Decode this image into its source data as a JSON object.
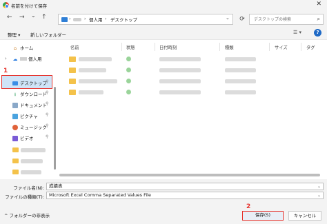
{
  "window": {
    "title": "名前を付けて保存",
    "close": "✕"
  },
  "nav": {
    "back": "←",
    "forward": "→",
    "down": "⌄",
    "up": "↑",
    "refresh": "⟳"
  },
  "address": {
    "sep1": "›",
    "path1": "個人用",
    "sep2": "›",
    "path2": "デスクトップ",
    "dropdown": "⌄"
  },
  "search": {
    "placeholder": "デスクトップの検索",
    "icon": "⌕"
  },
  "toolbar": {
    "organize": "整理 ▾",
    "new_folder": "新しいフォルダー",
    "view": "☰ ▾",
    "help": "?"
  },
  "sidebar": {
    "home": "ホーム",
    "personal": "個人用",
    "desktop": "デスクトップ",
    "downloads": "ダウンロード",
    "documents": "ドキュメント",
    "pictures": "ピクチャ",
    "music": "ミュージック",
    "videos": "ビデオ",
    "chevron": "›",
    "pin": "📌"
  },
  "columns": {
    "name": "名前",
    "status": "状態",
    "date": "日付時刻",
    "type": "種類",
    "size": "サイズ",
    "tag": "タグ"
  },
  "fields": {
    "filename_label": "ファイル名(N):",
    "filename_value": "成績表",
    "filetype_label": "ファイルの種類(T):",
    "filetype_value": "Microsoft Excel Comma Separated Values File",
    "drop": "⌄"
  },
  "footer": {
    "hide_folders": "^ フォルダーの非表示",
    "save": "保存(S)",
    "cancel": "キャンセル"
  },
  "annotations": {
    "one": "1",
    "two": "2"
  }
}
